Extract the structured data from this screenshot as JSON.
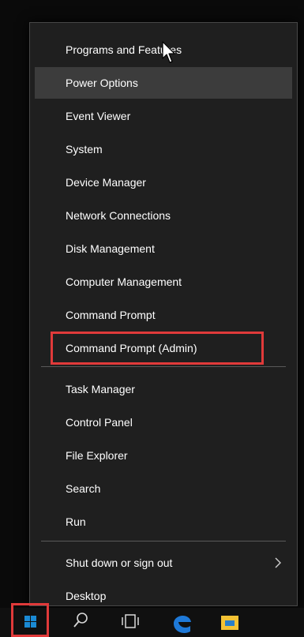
{
  "menu": {
    "items": [
      {
        "label": "Programs and Features"
      },
      {
        "label": "Power Options"
      },
      {
        "label": "Event Viewer"
      },
      {
        "label": "System"
      },
      {
        "label": "Device Manager"
      },
      {
        "label": "Network Connections"
      },
      {
        "label": "Disk Management"
      },
      {
        "label": "Computer Management"
      },
      {
        "label": "Command Prompt"
      },
      {
        "label": "Command Prompt (Admin)"
      },
      {
        "label": "Task Manager"
      },
      {
        "label": "Control Panel"
      },
      {
        "label": "File Explorer"
      },
      {
        "label": "Search"
      },
      {
        "label": "Run"
      },
      {
        "label": "Shut down or sign out"
      },
      {
        "label": "Desktop"
      }
    ],
    "hovered_item": "Power Options",
    "highlighted_item": "Command Prompt (Admin)"
  },
  "taskbar": {
    "icons": [
      "windows-start-icon",
      "search-icon",
      "task-view-icon",
      "edge-icon",
      "file-explorer-icon"
    ],
    "highlighted_icon": "windows-start-icon"
  },
  "colors": {
    "menu_bg": "#1f1f1f",
    "hover_bg": "#3c3c3c",
    "highlight_border": "#e03a3a",
    "text": "#ffffff",
    "start_blue": "#1a8ad4",
    "edge_blue": "#1e79d8",
    "explorer_yellow": "#f3c234"
  }
}
